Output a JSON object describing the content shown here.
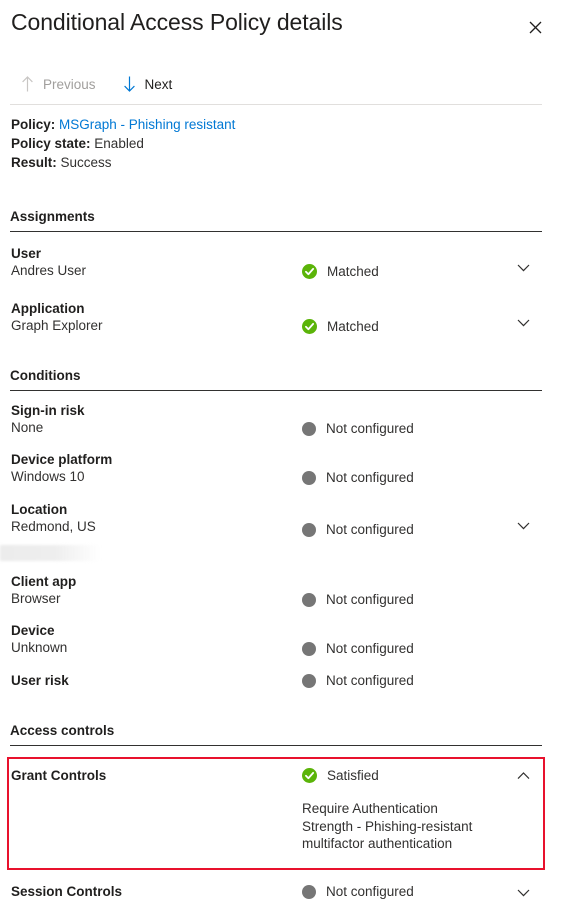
{
  "header": {
    "title": "Conditional Access Policy details",
    "close_icon": "close-icon"
  },
  "commandbar": {
    "previous": {
      "label": "Previous",
      "icon": "arrow-up-icon",
      "enabled": false
    },
    "next": {
      "label": "Next",
      "icon": "arrow-down-icon",
      "enabled": true
    }
  },
  "summary": {
    "policy_label": "Policy:",
    "policy_value": "MSGraph - Phishing resistant",
    "policy_state_label": "Policy state:",
    "policy_state_value": "Enabled",
    "result_label": "Result:",
    "result_value": "Success"
  },
  "sections": {
    "assignments": "Assignments",
    "conditions": "Conditions",
    "access_controls": "Access controls"
  },
  "assignments": [
    {
      "name": "User",
      "sub": "Andres User",
      "status": "Matched",
      "status_icon": "check-circle-icon",
      "chevron": "chevron-down-icon"
    },
    {
      "name": "Application",
      "sub": "Graph Explorer",
      "status": "Matched",
      "status_icon": "check-circle-icon",
      "chevron": "chevron-down-icon"
    }
  ],
  "conditions": [
    {
      "name": "Sign-in risk",
      "sub": "None",
      "status": "Not configured",
      "status_icon": "grey-dot-icon",
      "chevron": null
    },
    {
      "name": "Device platform",
      "sub": "Windows 10",
      "status": "Not configured",
      "status_icon": "grey-dot-icon",
      "chevron": null
    },
    {
      "name": "Location",
      "sub": "Redmond, US",
      "status": "Not configured",
      "status_icon": "grey-dot-icon",
      "chevron": "chevron-down-icon"
    },
    {
      "name": "Client app",
      "sub": "Browser",
      "status": "Not configured",
      "status_icon": "grey-dot-icon",
      "chevron": null
    },
    {
      "name": "Device",
      "sub": "Unknown",
      "status": "Not configured",
      "status_icon": "grey-dot-icon",
      "chevron": null
    },
    {
      "name": "User risk",
      "sub": "",
      "status": "Not configured",
      "status_icon": "grey-dot-icon",
      "chevron": null
    }
  ],
  "access_controls": [
    {
      "name": "Grant Controls",
      "sub": "",
      "status": "Satisfied",
      "status_icon": "check-circle-icon",
      "chevron": "chevron-up-icon",
      "detail": "Require Authentication Strength - Phishing-resistant multifactor authentication",
      "highlighted": true
    },
    {
      "name": "Session Controls",
      "sub": "",
      "status": "Not configured",
      "status_icon": "grey-dot-icon",
      "chevron": "chevron-down-icon"
    }
  ],
  "colors": {
    "link": "#0078d4",
    "success_green": "#5bb409",
    "neutral_grey": "#767676",
    "highlight_red": "#e8112d",
    "text_primary": "#201f1e",
    "text_secondary": "#323130",
    "disabled": "#a19f9d"
  }
}
